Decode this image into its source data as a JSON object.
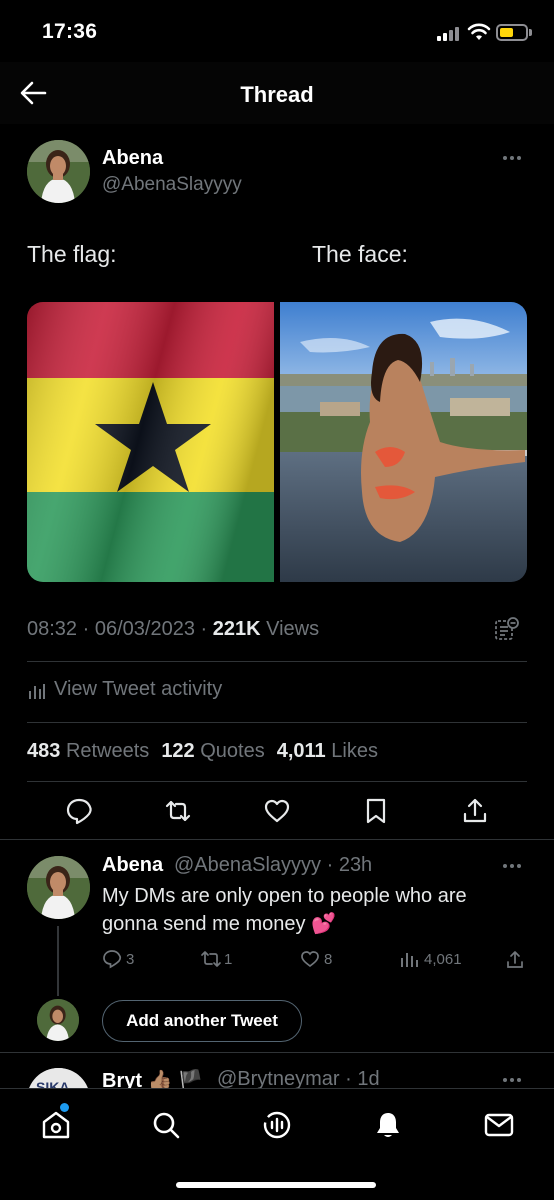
{
  "status_bar": {
    "time": "17:36"
  },
  "header": {
    "title": "Thread"
  },
  "tweet": {
    "author_name": "Abena",
    "author_handle": "@AbenaSlayyyy",
    "text_left": "The flag:",
    "text_right": "The face:",
    "time": "08:32",
    "date": "06/03/2023",
    "views_count": "221K",
    "views_label": "Views",
    "activity_label": "View Tweet activity",
    "retweets_count": "483",
    "retweets_label": "Retweets",
    "quotes_count": "122",
    "quotes_label": "Quotes",
    "likes_count": "4,011",
    "likes_label": "Likes"
  },
  "reply": {
    "author_name": "Abena",
    "author_handle_time": "@AbenaSlayyyy · 23h",
    "text": "My DMs are only open to people who are gonna send me money 💕",
    "replies": "3",
    "retweets": "1",
    "likes": "8",
    "views": "4,061"
  },
  "composer": {
    "add_label": "Add another Tweet"
  },
  "next_tweet": {
    "author_name": "Bryt 👍🏽 🏴",
    "author_handle_time": "@Brytneymar · 1d"
  },
  "colors": {
    "accent": "#1d9bf0",
    "secondary_text": "#71767b",
    "divider": "#2f3336"
  }
}
